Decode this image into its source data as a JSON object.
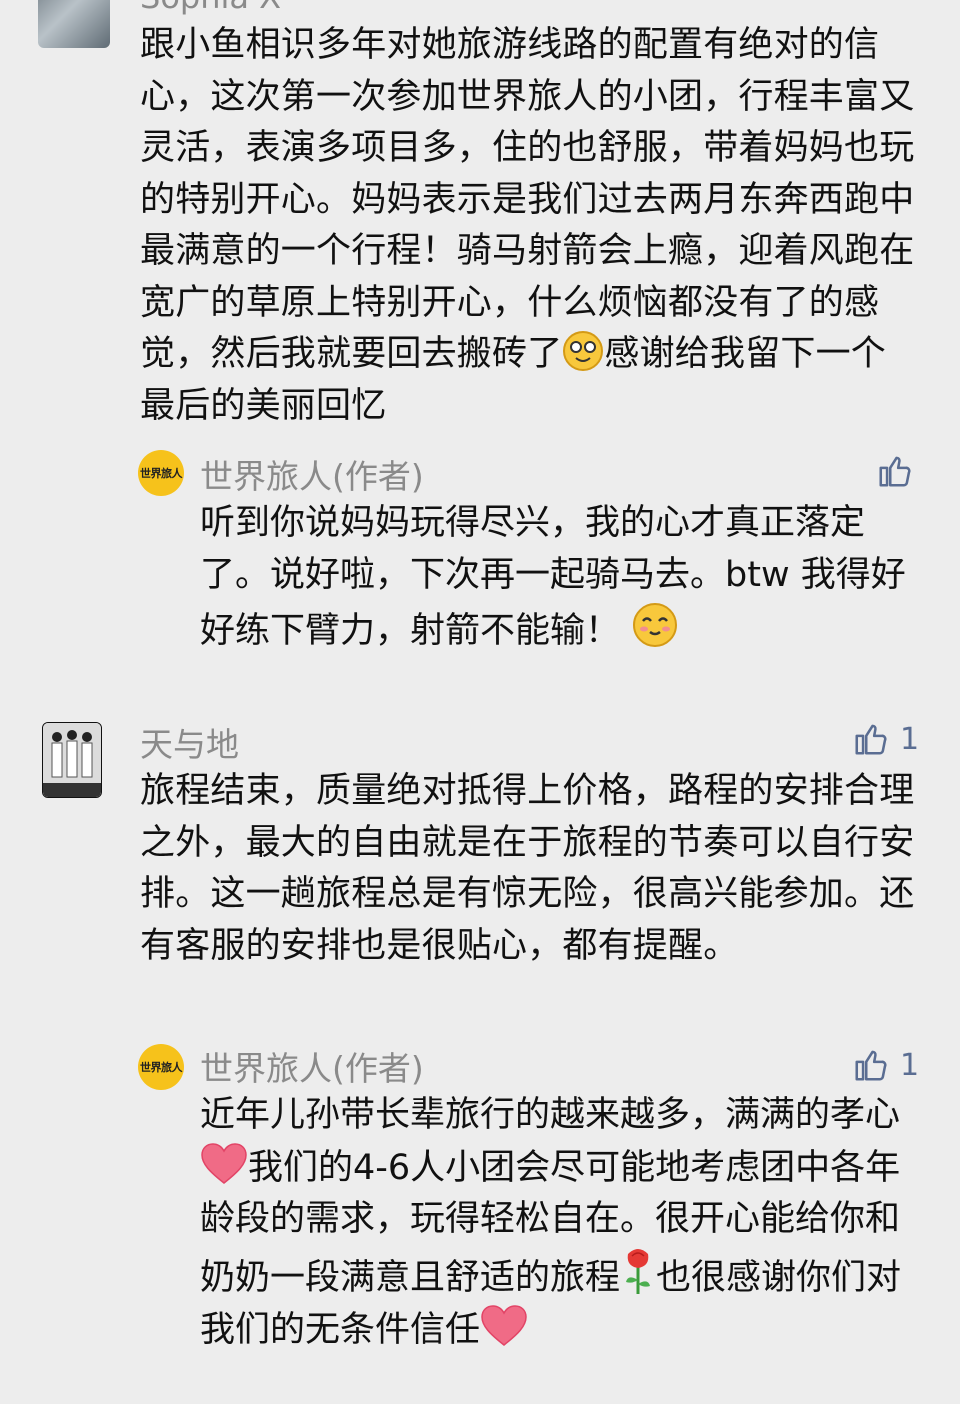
{
  "comments": [
    {
      "author": "Sophia X",
      "likes": "",
      "text_before_emoji": "跟小鱼相识多年对她旅游线路的配置有绝对的信心，这次第一次参加世界旅人的小团，行程丰富又灵活，表演多项目多，住的也舒服，带着妈妈也玩的特别开心。妈妈表示是我们过去两月东奔西跑中最满意的一个行程！骑马射箭会上瘾，迎着风跑在宽广的草原上特别开心，什么烦恼都没有了的感觉，然后我就要回去搬砖了",
      "text_after_emoji": "感谢给我留下一个最后的美丽回忆",
      "reply": {
        "author": "世界旅人(作者)",
        "logo_text": "世界旅人",
        "likes": "",
        "text": "听到你说妈妈玩得尽兴，我的心才真正落定了。说好啦，下次再一起骑马去。btw 我得好好练下臂力，射箭不能输！"
      }
    },
    {
      "author": "天与地",
      "likes": "1",
      "text": "旅程结束，质量绝对抵得上价格，路程的安排合理之外，最大的自由就是在于旅程的节奏可以自行安排。这一趟旅程总是有惊无险，很高兴能参加。还有客服的安排也是很贴心，都有提醒。",
      "reply": {
        "author": "世界旅人(作者)",
        "logo_text": "世界旅人",
        "likes": "1",
        "text_part1": "近年儿孙带长辈旅行的越来越多，满满的孝心",
        "text_part2": "我们的4-6人小团会尽可能地考虑团中各年龄段的需求，玩得轻松自在。很开心能给你和奶奶一段满意且舒适的旅程",
        "text_part3": "也很感谢你们对我们的无条件信任"
      }
    }
  ],
  "colors": {
    "background": "#ededed",
    "like_blue": "#5a6d92",
    "logo_yellow": "#f6c21b"
  }
}
